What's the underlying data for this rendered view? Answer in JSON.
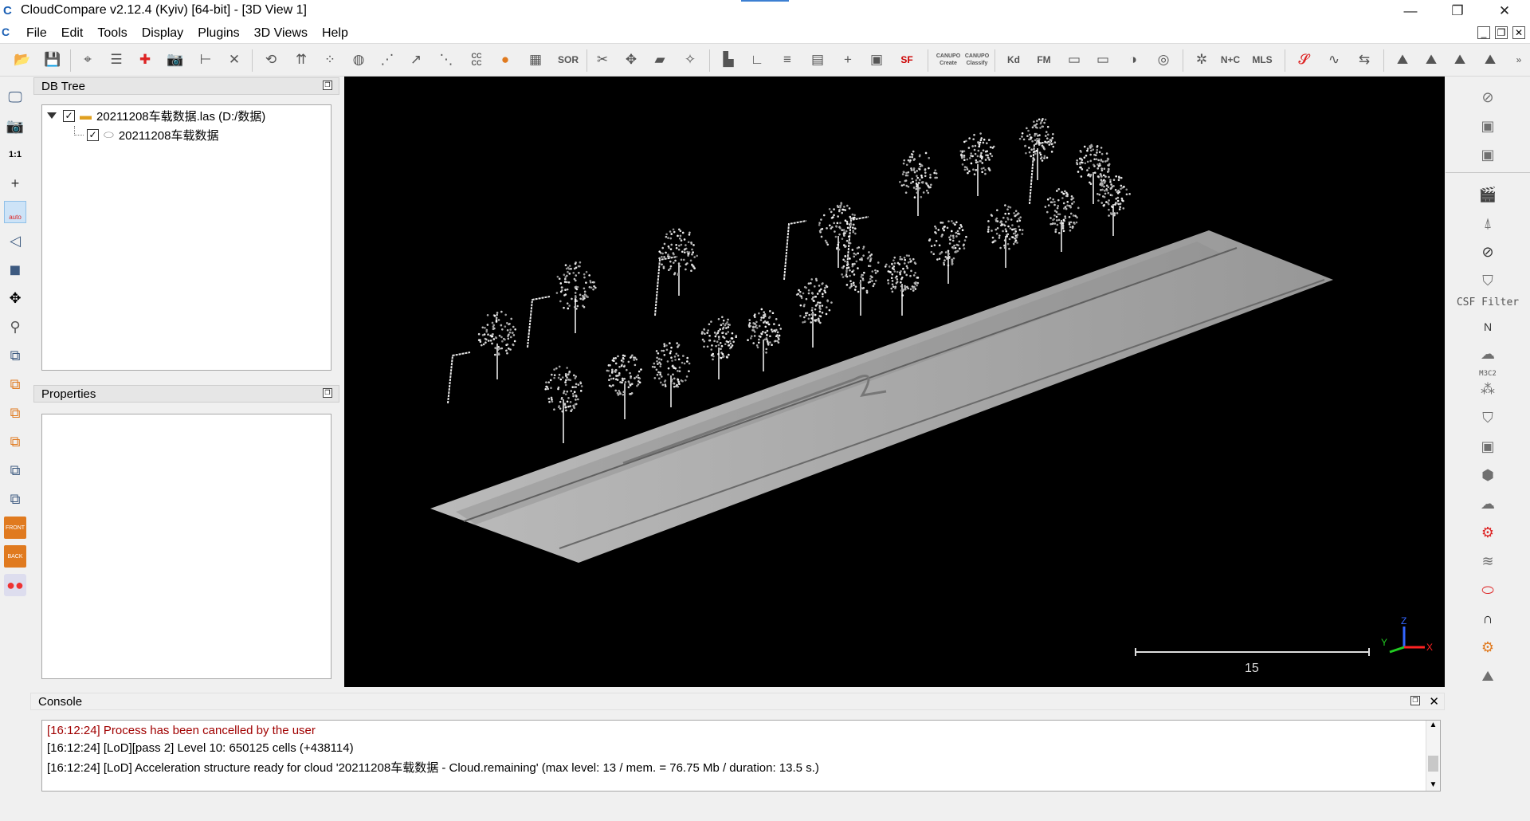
{
  "window": {
    "title": "CloudCompare v2.12.4 (Kyiv) [64-bit] - [3D View 1]",
    "app_icon": "C",
    "minimize": "—",
    "restore": "❐",
    "close": "✕"
  },
  "menu": [
    "File",
    "Edit",
    "Tools",
    "Display",
    "Plugins",
    "3D Views",
    "Help"
  ],
  "mdi_buttons": [
    "_",
    "❐",
    "✕"
  ],
  "toolbar": {
    "labels": {
      "cc": "CC\nCC",
      "sor": "SOR",
      "sf": "SF",
      "canupo_create": "CANUPO\nCreate",
      "canupo_classify": "CANUPO\nClassify",
      "kd": "Kd",
      "fm": "FM",
      "nc": "N+C",
      "mls": "MLS"
    }
  },
  "left_tools": {
    "one_to_one": "1:1",
    "auto": "auto",
    "front": "FRONT",
    "back": "BACK"
  },
  "db_tree": {
    "title": "DB Tree",
    "items": [
      {
        "label": "20211208车载数据.las (D:/数据)",
        "checked": true,
        "icon": "folder-icon"
      },
      {
        "label": "20211208车载数据",
        "checked": true,
        "icon": "cloud-icon"
      }
    ]
  },
  "properties": {
    "title": "Properties"
  },
  "view3d": {
    "scale_label": "15",
    "axis": {
      "z": "Z",
      "y": "Y",
      "x": "X"
    }
  },
  "right_tools": {
    "csf_filter": "CSF Filter",
    "n_label": "N",
    "m3c2": "M3C2"
  },
  "console": {
    "title": "Console",
    "lines": [
      {
        "text": "[16:12:24] Process has been cancelled by the user",
        "color": "#a00000"
      },
      {
        "text": "[16:12:24] [LoD][pass 2] Level 10: 650125 cells (+438114)",
        "color": "#000000"
      },
      {
        "text": "[16:12:24] [LoD] Acceleration structure ready for cloud '20211208车载数据 - Cloud.remaining' (max level: 13 / mem. = 76.75 Mb / duration: 13.5 s.)",
        "color": "#000000"
      }
    ]
  }
}
